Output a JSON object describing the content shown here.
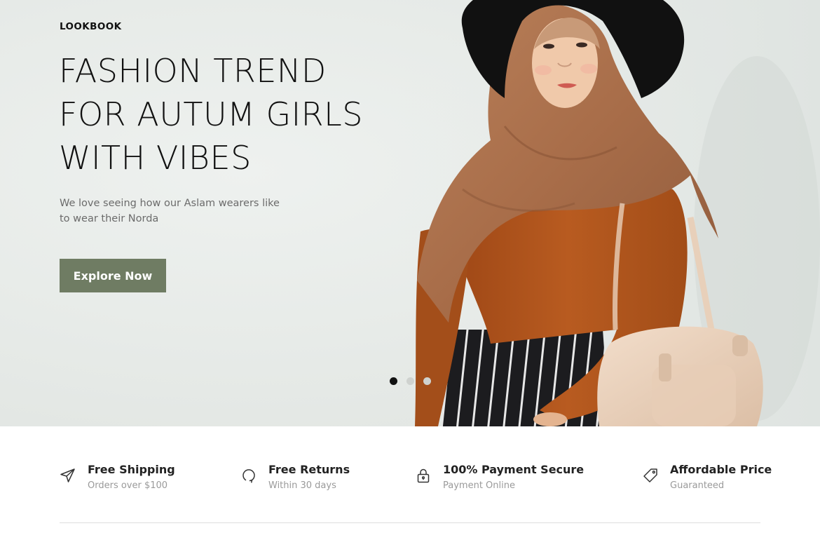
{
  "hero": {
    "eyebrow": "LOOKBOOK",
    "title_lines": [
      "FASHION TREND",
      "FOR AUTUM GIRLS",
      "WITH VIBES"
    ],
    "description": "We love seeing how our Aslam wearers like to wear their Norda",
    "button_label": "Explore Now",
    "slides_total": 3,
    "active_slide": 1
  },
  "features": [
    {
      "icon": "paper-plane-icon",
      "title": "Free Shipping",
      "subtitle": "Orders over $100"
    },
    {
      "icon": "refresh-icon",
      "title": "Free Returns",
      "subtitle": "Within 30 days"
    },
    {
      "icon": "lock-icon",
      "title": "100% Payment Secure",
      "subtitle": "Payment Online"
    },
    {
      "icon": "price-tag-icon",
      "title": "Affordable Price",
      "subtitle": "Guaranteed"
    }
  ],
  "colors": {
    "accent_button": "#6f7c63",
    "hero_background": "#e6eae7",
    "scarf": "#a86f4c",
    "sweater": "#b4571e",
    "hat": "#111111",
    "bag": "#ecd4bf"
  }
}
